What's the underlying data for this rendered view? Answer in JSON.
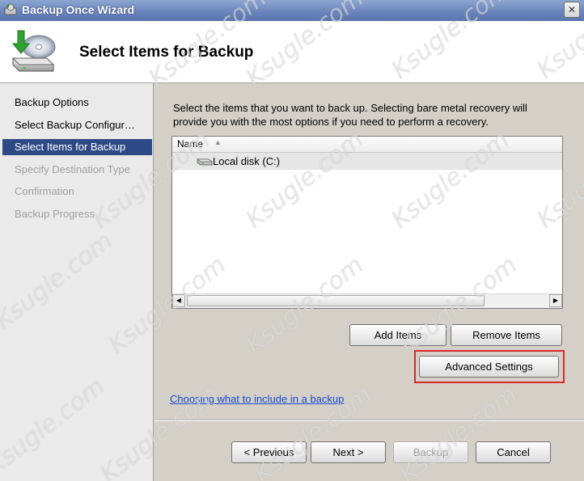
{
  "window": {
    "title": "Backup Once Wizard",
    "close_glyph": "✕"
  },
  "header": {
    "title": "Select Items for Backup"
  },
  "sidebar": {
    "steps": [
      {
        "label": "Backup Options",
        "state": "done"
      },
      {
        "label": "Select Backup Configur…",
        "state": "done"
      },
      {
        "label": "Select Items for Backup",
        "state": "active"
      },
      {
        "label": "Specify Destination Type",
        "state": "pending"
      },
      {
        "label": "Confirmation",
        "state": "pending"
      },
      {
        "label": "Backup Progress",
        "state": "pending"
      }
    ]
  },
  "main": {
    "description": "Select the items that you want to back up. Selecting bare metal recovery will provide you with the most options if you need to perform a recovery.",
    "list": {
      "column_header": "Name",
      "sort_indicator": "▲",
      "items": [
        {
          "label": "Local disk (C:)",
          "icon": "hard-drive-icon"
        }
      ]
    },
    "scroll_left_glyph": "◀",
    "scroll_right_glyph": "▶",
    "add_items_label": "Add Items",
    "remove_items_label": "Remove Items",
    "advanced_settings_label": "Advanced Settings",
    "help_link": "Choosing what to include in a backup"
  },
  "footer": {
    "previous_label": "< Previous",
    "next_label": "Next >",
    "backup_label": "Backup",
    "cancel_label": "Cancel"
  },
  "watermark": {
    "text": "Ksugle.com"
  },
  "colors": {
    "titlebar": "#6b86bd",
    "active_step": "#2e4a86",
    "highlight_box": "#d42a2a",
    "link": "#1a4acb"
  }
}
